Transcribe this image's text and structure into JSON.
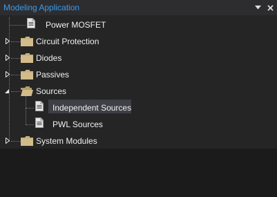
{
  "panel": {
    "title": "Modeling Application",
    "dropdown_icon": "chevron-down-icon",
    "close_icon": "close-icon"
  },
  "colors": {
    "title": "#3d9be9",
    "header_bg": "#2d2d30",
    "tree_bg": "#252526",
    "selection_bg": "#3f3f46",
    "folder": "#c8b27f"
  },
  "tree": {
    "items": [
      {
        "label": "Power MOSFET",
        "type": "document",
        "level": 1
      },
      {
        "label": "Circuit Protection",
        "type": "folder",
        "level": 0,
        "state": "collapsed"
      },
      {
        "label": "Diodes",
        "type": "folder",
        "level": 0,
        "state": "collapsed"
      },
      {
        "label": "Passives",
        "type": "folder",
        "level": 0,
        "state": "collapsed"
      },
      {
        "label": "Sources",
        "type": "folder",
        "level": 0,
        "state": "expanded"
      },
      {
        "label": "Independent Sources",
        "type": "document",
        "level": 1,
        "selected": true
      },
      {
        "label": "PWL Sources",
        "type": "document",
        "level": 1
      },
      {
        "label": "System Modules",
        "type": "folder",
        "level": 0,
        "state": "collapsed"
      }
    ]
  }
}
